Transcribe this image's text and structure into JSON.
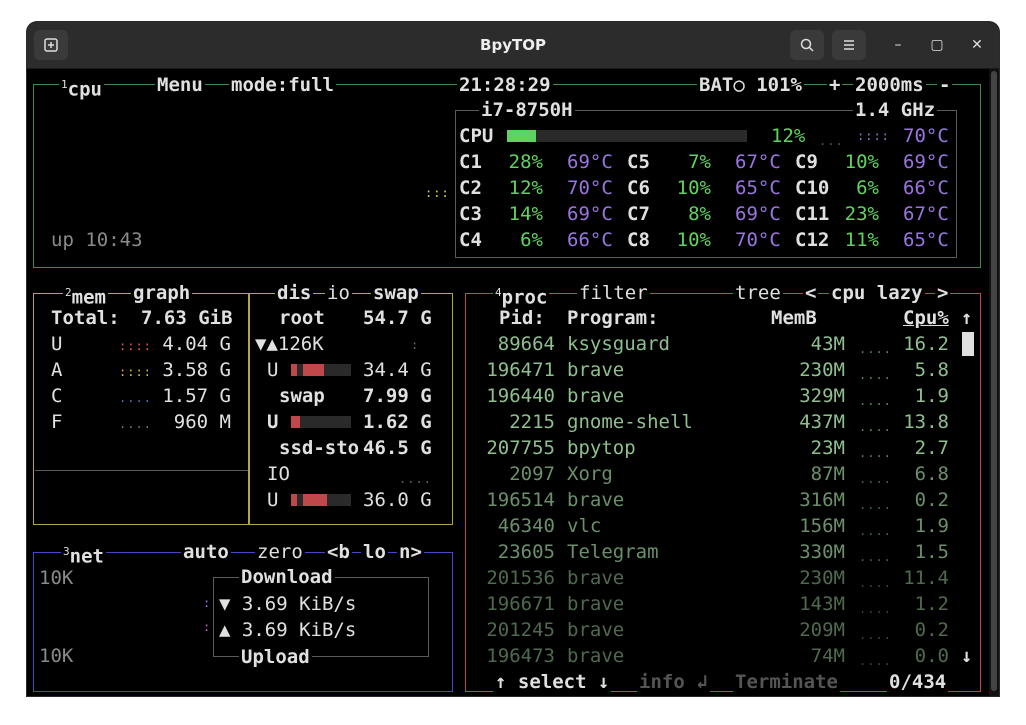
{
  "window": {
    "title": "BpyTOP"
  },
  "colors": {
    "cpu_box": "#3d8b4f",
    "mem_box": "#b5a642",
    "net_box": "#4747c8",
    "proc_box": "#c0484a",
    "text": "#e0e0e0",
    "green": "#5fd35f",
    "purple": "#9a74e0",
    "grey": "#8a8a8a"
  },
  "cpu": {
    "header": {
      "num": "1",
      "name": "cpu",
      "menu": "Menu",
      "mode": "mode:full",
      "clock": "21:28:29",
      "battery": "BAT○ 101%",
      "plus": "+",
      "interval": "2000ms",
      "minus": "-"
    },
    "model": "i7-8750H",
    "freq": "1.4 GHz",
    "total_label": "CPU",
    "total_pct": "12%",
    "total_fraction": 0.12,
    "total_temp": "70°C",
    "uptime": "up 10:43",
    "cores": [
      {
        "name": "C1",
        "pct": "28%",
        "temp": "69°C"
      },
      {
        "name": "C2",
        "pct": "12%",
        "temp": "70°C"
      },
      {
        "name": "C3",
        "pct": "14%",
        "temp": "69°C"
      },
      {
        "name": "C4",
        "pct": "6%",
        "temp": "66°C"
      },
      {
        "name": "C5",
        "pct": "7%",
        "temp": "67°C"
      },
      {
        "name": "C6",
        "pct": "10%",
        "temp": "65°C"
      },
      {
        "name": "C7",
        "pct": "8%",
        "temp": "69°C"
      },
      {
        "name": "C8",
        "pct": "10%",
        "temp": "70°C"
      },
      {
        "name": "C9",
        "pct": "10%",
        "temp": "69°C"
      },
      {
        "name": "C10",
        "pct": "6%",
        "temp": "66°C"
      },
      {
        "name": "C11",
        "pct": "23%",
        "temp": "67°C"
      },
      {
        "name": "C12",
        "pct": "11%",
        "temp": "65°C"
      }
    ]
  },
  "mem": {
    "header": {
      "num": "2",
      "name": "mem",
      "graph": "graph"
    },
    "total_label": "Total:",
    "total_value": "7.63 GiB",
    "rows": [
      {
        "label": "U",
        "value": "4.04 G"
      },
      {
        "label": "A",
        "value": "3.58 G"
      },
      {
        "label": "C",
        "value": "1.57 G"
      },
      {
        "label": "F",
        "value": "960 M"
      }
    ]
  },
  "disks": {
    "header": {
      "dis": "dis",
      "io": "io",
      "swap": "swap"
    },
    "root_name": "root",
    "root_size": "54.7 G",
    "io_speed": "▼▲126K",
    "root_used_label": "U",
    "root_used": "34.4 G",
    "swap_name": "swap",
    "swap_size": "7.99 G",
    "swap_used_label": "U",
    "swap_used": "1.62 G",
    "ssd_name": "ssd-sto",
    "ssd_size": "46.5 G",
    "ssd_io": "IO",
    "ssd_used_label": "U",
    "ssd_used": "36.0 G"
  },
  "net": {
    "header": {
      "num": "3",
      "name": "net",
      "auto": "auto",
      "zero": "zero",
      "b": "<b",
      "lo": "lo",
      "n": "n>"
    },
    "scale_top": "10K",
    "scale_bottom": "10K",
    "download_label": "Download",
    "download_rate": "3.69 KiB/s",
    "upload_label": "Upload",
    "upload_rate": "3.69 KiB/s",
    "down_arrow": "▼",
    "up_arrow": "▲"
  },
  "proc": {
    "header": {
      "num": "4",
      "name": "proc",
      "filter": "filter",
      "tree": "tree",
      "prev": "<",
      "sort": "cpu lazy",
      "next": ">"
    },
    "columns": {
      "pid": "Pid:",
      "program": "Program:",
      "mem": "MemB",
      "cpu": "Cpu%"
    },
    "sort_arrow_up": "↑",
    "sort_arrow_down": "↓",
    "rows": [
      {
        "pid": "89664",
        "program": "ksysguard",
        "mem": "43M",
        "cpu": "16.2"
      },
      {
        "pid": "196471",
        "program": "brave",
        "mem": "230M",
        "cpu": "5.8"
      },
      {
        "pid": "196440",
        "program": "brave",
        "mem": "329M",
        "cpu": "1.9"
      },
      {
        "pid": "2215",
        "program": "gnome-shell",
        "mem": "437M",
        "cpu": "13.8"
      },
      {
        "pid": "207755",
        "program": "bpytop",
        "mem": "23M",
        "cpu": "2.7"
      },
      {
        "pid": "2097",
        "program": "Xorg",
        "mem": "87M",
        "cpu": "6.8"
      },
      {
        "pid": "196514",
        "program": "brave",
        "mem": "316M",
        "cpu": "0.2"
      },
      {
        "pid": "46340",
        "program": "vlc",
        "mem": "156M",
        "cpu": "1.9"
      },
      {
        "pid": "23605",
        "program": "Telegram",
        "mem": "330M",
        "cpu": "1.5"
      },
      {
        "pid": "201536",
        "program": "brave",
        "mem": "230M",
        "cpu": "11.4"
      },
      {
        "pid": "196671",
        "program": "brave",
        "mem": "143M",
        "cpu": "1.2"
      },
      {
        "pid": "201245",
        "program": "brave",
        "mem": "209M",
        "cpu": "0.2"
      },
      {
        "pid": "196473",
        "program": "brave",
        "mem": "74M",
        "cpu": "0.0"
      }
    ],
    "footer": {
      "select": "↑ select ↓",
      "info": "info ↲",
      "terminate": "Terminate",
      "count": "0/434"
    }
  }
}
